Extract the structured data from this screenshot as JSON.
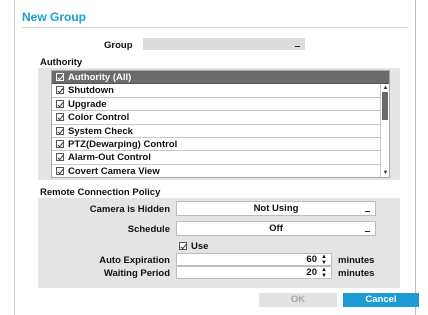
{
  "dialog": {
    "title": "New Group"
  },
  "group": {
    "label": "Group",
    "value": ""
  },
  "authority": {
    "section_label": "Authority",
    "items": [
      {
        "label": "Authority (All)",
        "checked": true,
        "selected": true
      },
      {
        "label": "Shutdown",
        "checked": true
      },
      {
        "label": "Upgrade",
        "checked": true
      },
      {
        "label": "Color Control",
        "checked": true
      },
      {
        "label": "System Check",
        "checked": true
      },
      {
        "label": "PTZ(Dewarping) Control",
        "checked": true
      },
      {
        "label": "Alarm-Out Control",
        "checked": true
      },
      {
        "label": "Covert Camera View",
        "checked": true
      }
    ],
    "scroll_up": "▲",
    "scroll_down": "▼"
  },
  "remote": {
    "section_label": "Remote Connection Policy",
    "camera_hidden_label": "Camera is Hidden",
    "camera_hidden_value": "Not Using",
    "schedule_label": "Schedule",
    "schedule_value": "Off",
    "use_label": "Use",
    "use_checked": true,
    "auto_expiration_label": "Auto Expiration",
    "auto_expiration_value": "60",
    "waiting_period_label": "Waiting Period",
    "waiting_period_value": "20",
    "unit_label": "minutes",
    "spin_glyph": "▲\n▼"
  },
  "buttons": {
    "ok": "OK",
    "cancel": "Cancel"
  },
  "colors": {
    "accent": "#1e9bd3",
    "selected_row": "#6a6a6a",
    "panel_bg": "#e4e4e4"
  }
}
